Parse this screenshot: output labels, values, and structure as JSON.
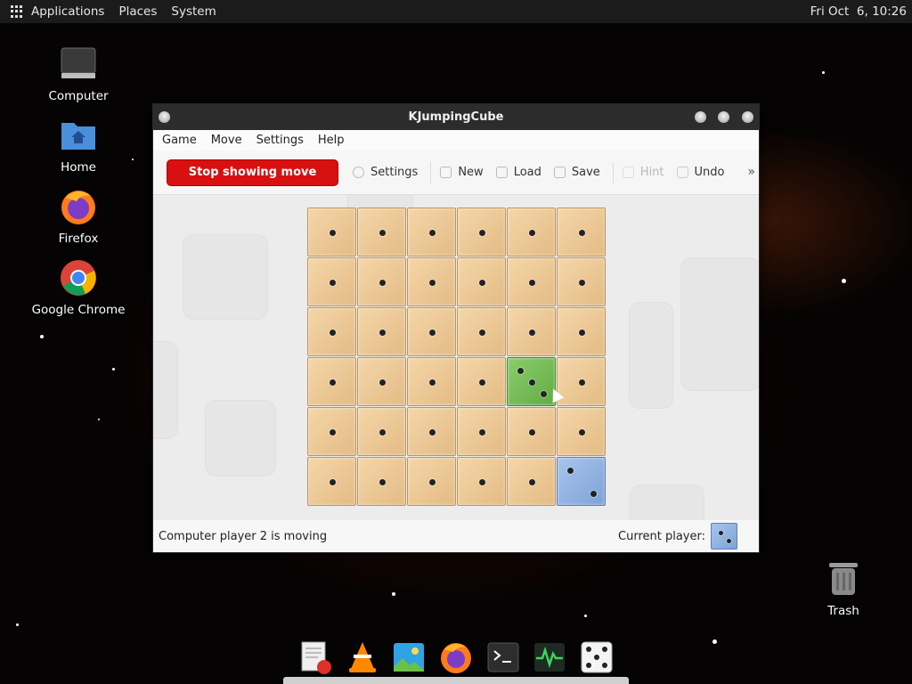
{
  "top_panel": {
    "menus": [
      "Applications",
      "Places",
      "System"
    ],
    "clock": "Fri Oct  6, 10:26"
  },
  "desktop_icons": [
    {
      "label": "Computer",
      "icon": "computer-icon"
    },
    {
      "label": "Home",
      "icon": "home-folder-icon"
    },
    {
      "label": "Firefox",
      "icon": "firefox-icon"
    },
    {
      "label": "Google Chrome",
      "icon": "chrome-icon"
    }
  ],
  "trash": {
    "label": "Trash",
    "icon": "trash-icon"
  },
  "window": {
    "title": "KJumpingCube",
    "menu": [
      "Game",
      "Move",
      "Settings",
      "Help"
    ],
    "toolbar": {
      "stop_label": "Stop showing move",
      "settings": "Settings",
      "new": "New",
      "load": "Load",
      "save": "Save",
      "hint": "Hint",
      "undo": "Undo",
      "more": "»"
    },
    "status": "Computer player 2 is moving",
    "current_player_label": "Current player:"
  },
  "board": {
    "size": 6,
    "cells": [
      [
        "neutral",
        "neutral",
        "neutral",
        "neutral",
        "neutral",
        "neutral"
      ],
      [
        "neutral",
        "neutral",
        "neutral",
        "neutral",
        "neutral",
        "neutral"
      ],
      [
        "neutral",
        "neutral",
        "neutral",
        "neutral",
        "neutral",
        "neutral"
      ],
      [
        "neutral",
        "neutral",
        "neutral",
        "neutral",
        "green",
        "neutral"
      ],
      [
        "neutral",
        "neutral",
        "neutral",
        "neutral",
        "neutral",
        "neutral"
      ],
      [
        "neutral",
        "neutral",
        "neutral",
        "neutral",
        "neutral",
        "blue"
      ]
    ],
    "dots": [
      [
        1,
        1,
        1,
        1,
        1,
        1
      ],
      [
        1,
        1,
        1,
        1,
        1,
        1
      ],
      [
        1,
        1,
        1,
        1,
        1,
        1
      ],
      [
        1,
        1,
        1,
        1,
        3,
        1
      ],
      [
        1,
        1,
        1,
        1,
        1,
        1
      ],
      [
        1,
        1,
        1,
        1,
        1,
        2
      ]
    ],
    "colors": {
      "neutral": "#eac79a",
      "green": "#72bb52",
      "blue": "#8fb1e2",
      "stop_button": "#d81010"
    }
  },
  "dock": [
    "text-editor-icon",
    "vlc-icon",
    "image-viewer-icon",
    "firefox-icon",
    "terminal-icon",
    "system-monitor-icon",
    "dice-icon"
  ]
}
